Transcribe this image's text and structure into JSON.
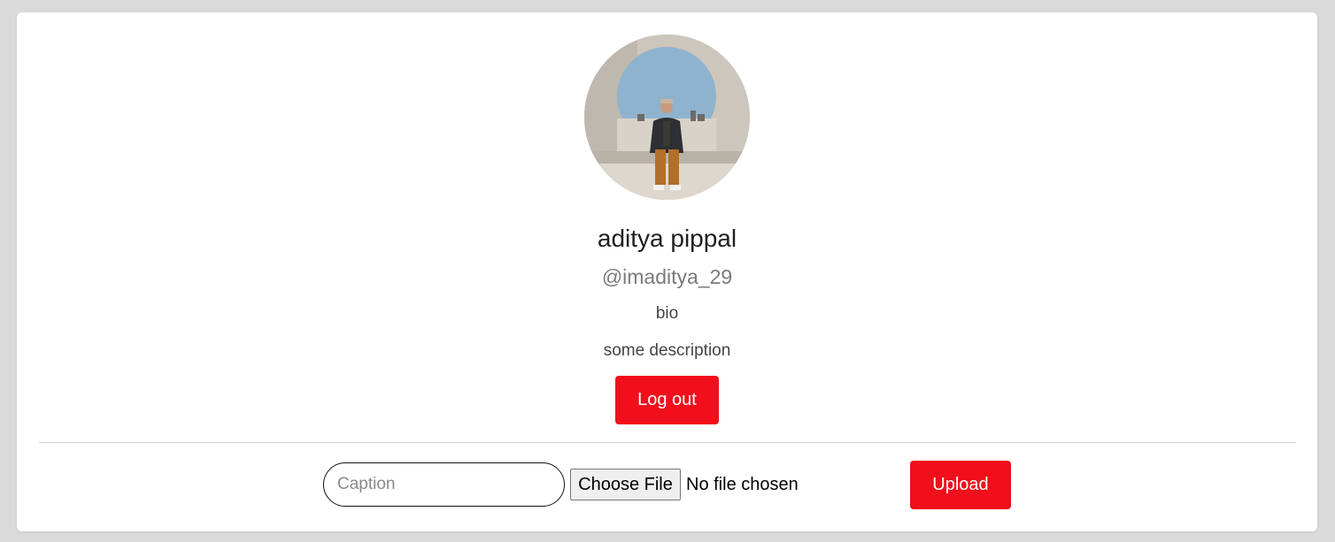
{
  "profile": {
    "name": "aditya pippal",
    "handle": "@imaditya_29",
    "bio_label": "bio",
    "bio_text": "some description",
    "logout_label": "Log out"
  },
  "upload": {
    "caption_placeholder": "Caption",
    "choose_file_label": "Choose File",
    "file_status": "No file chosen",
    "upload_label": "Upload"
  },
  "colors": {
    "accent": "#f00f1b",
    "background": "#dadada",
    "card": "#ffffff"
  },
  "icons": {
    "avatar": "profile-photo"
  }
}
